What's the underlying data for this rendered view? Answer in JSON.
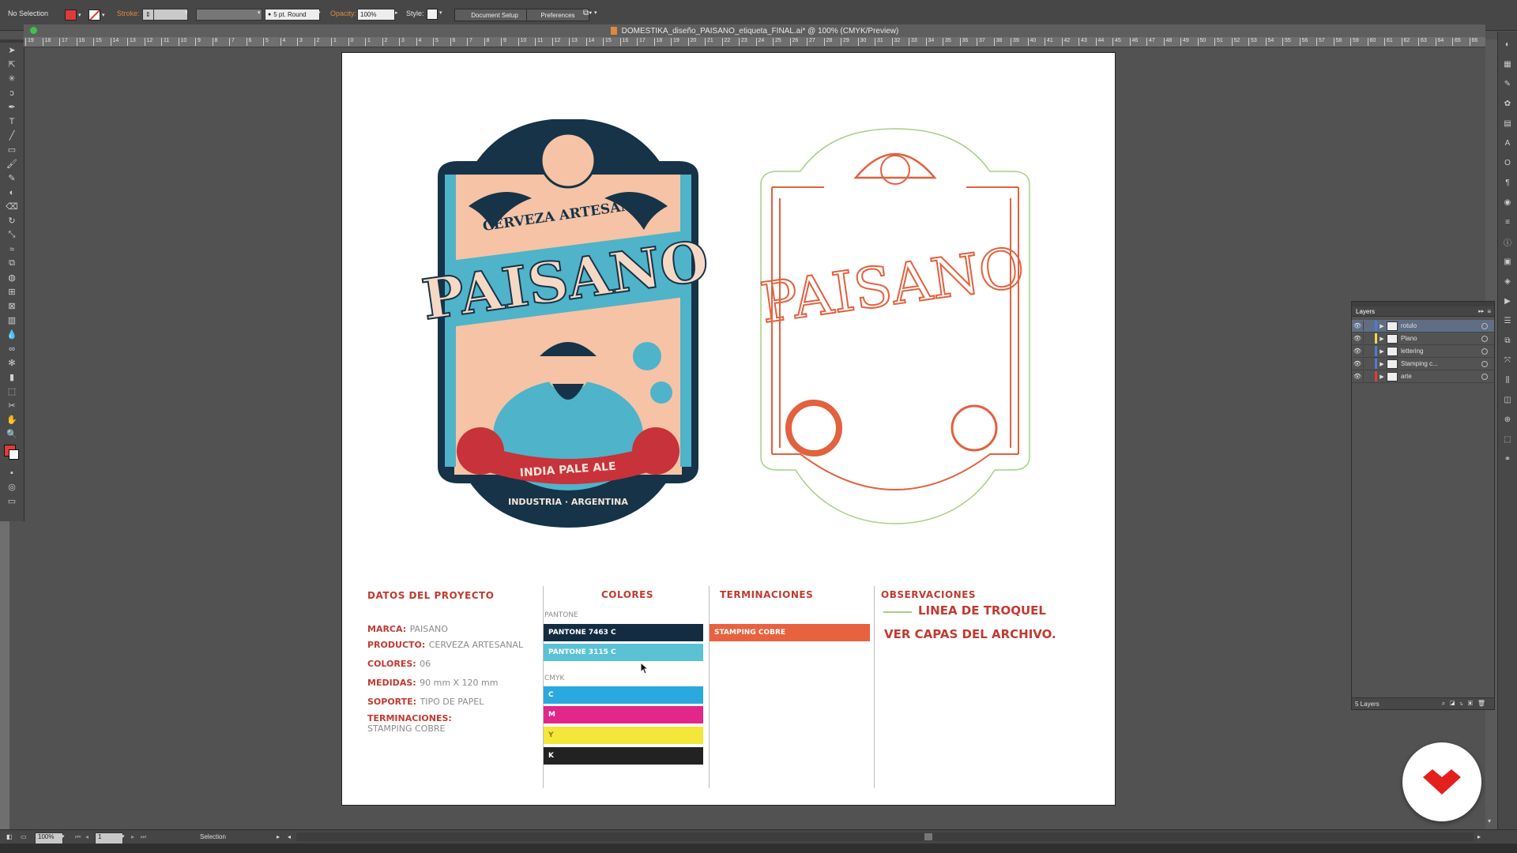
{
  "control_bar": {
    "selection_status": "No Selection",
    "fill_color": "#e03a3a",
    "stroke_label": "Stroke:",
    "brush_value": "5 pt. Round",
    "opacity_label": "Opacity:",
    "opacity_value": "100%",
    "style_label": "Style:",
    "document_setup_label": "Document Setup",
    "preferences_label": "Preferences"
  },
  "document": {
    "title": "DOMESTIKA_diseño_PAISANO_etiqueta_FINAL.ai* @ 100% (CMYK/Preview)"
  },
  "ruler_marks": [
    "19",
    "18",
    "17",
    "16",
    "15",
    "14",
    "13",
    "12",
    "11",
    "10",
    "9",
    "8",
    "7",
    "6",
    "5",
    "4",
    "3",
    "2",
    "1",
    "0",
    "1",
    "2",
    "3",
    "4",
    "5",
    "6",
    "7",
    "8",
    "9",
    "10",
    "11",
    "12",
    "13",
    "14",
    "15",
    "16",
    "17",
    "18",
    "19",
    "20",
    "21",
    "22",
    "23",
    "24",
    "25",
    "26",
    "27",
    "28",
    "29",
    "30",
    "31",
    "32",
    "33",
    "34",
    "35",
    "36",
    "37",
    "38",
    "39",
    "40",
    "41",
    "42",
    "43",
    "44",
    "45",
    "46",
    "47",
    "48",
    "49",
    "50",
    "51",
    "52",
    "53",
    "54",
    "55",
    "56",
    "57",
    "58",
    "59",
    "60",
    "61",
    "62",
    "63",
    "64",
    "65",
    "66",
    "67"
  ],
  "tools": [
    "selection-tool",
    "direct-selection-tool",
    "magic-wand-tool",
    "lasso-tool",
    "pen-tool",
    "type-tool",
    "line-tool",
    "rectangle-tool",
    "paintbrush-tool",
    "pencil-tool",
    "blob-brush-tool",
    "eraser-tool",
    "rotate-tool",
    "scale-tool",
    "width-tool",
    "free-transform-tool",
    "shape-builder-tool",
    "perspective-grid-tool",
    "mesh-tool",
    "gradient-tool",
    "eyedropper-tool",
    "blend-tool",
    "symbol-sprayer-tool",
    "column-graph-tool",
    "artboard-tool",
    "slice-tool",
    "hand-tool",
    "zoom-tool"
  ],
  "label_art": {
    "brand": "PAISANO",
    "subtitle": "CERVEZA ARTESANAL",
    "style": "INDIA PALE ALE",
    "origin": "INDUSTRIA · ARGENTINA",
    "stamp_text": "CERVEZA ARTESANAL PAISANO",
    "colors": {
      "navy": "#163348",
      "teal": "#4fb3c9",
      "peach": "#f6c3a6",
      "red": "#c8323a",
      "copper": "#e2613e",
      "troquel": "#a7cf86"
    }
  },
  "project_info": {
    "title": "DATOS DEL PROYECTO",
    "fields": [
      {
        "label": "MARCA:",
        "value": "PAISANO"
      },
      {
        "label": "PRODUCTO:",
        "value": "CERVEZA ARTESANAL"
      },
      {
        "label": "COLORES:",
        "value": "06"
      },
      {
        "label": "MEDIDAS:",
        "value": "90 mm X 120 mm"
      },
      {
        "label": "SOPORTE:",
        "value": "TIPO DE PAPEL"
      },
      {
        "label": "TERMINACIONES:",
        "value": "STAMPING COBRE"
      }
    ]
  },
  "colores": {
    "title": "COLORES",
    "pantone_label": "PANTONE",
    "cmyk_label": "CMYK",
    "pantone": [
      {
        "name": "PANTONE 7463 C",
        "color": "#132c42"
      },
      {
        "name": "PANTONE 3115 C",
        "color": "#5bc2d6"
      }
    ],
    "cmyk": [
      {
        "name": "C",
        "color": "#2aa9de"
      },
      {
        "name": "M",
        "color": "#e2268a"
      },
      {
        "name": "Y",
        "color": "#f5e63a"
      },
      {
        "name": "K",
        "color": "#222222"
      }
    ]
  },
  "terminaciones": {
    "title": "TERMINACIONES",
    "items": [
      {
        "name": "STAMPING COBRE",
        "color": "#e8623f"
      }
    ]
  },
  "observaciones": {
    "title": "OBSERVACIONES",
    "line1": "LINEA DE TROQUEL",
    "line2": "VER CAPAS DEL ARCHIVO.",
    "line_color": "#a7cf86"
  },
  "layers_panel": {
    "title": "Layers",
    "footer": "5 Layers",
    "layers": [
      {
        "name": "rotulo",
        "color": "#4f7bd8",
        "selected": true
      },
      {
        "name": "Plano",
        "color": "#f2d84b",
        "selected": false
      },
      {
        "name": "lettering",
        "color": "#4f7bd8",
        "selected": false
      },
      {
        "name": "Stamping c...",
        "color": "#4f7bd8",
        "selected": false
      },
      {
        "name": "arte",
        "color": "#e23b3b",
        "selected": false
      }
    ]
  },
  "status_bar": {
    "zoom": "100%",
    "artboard_number": "1",
    "tool_name": "Selection"
  }
}
